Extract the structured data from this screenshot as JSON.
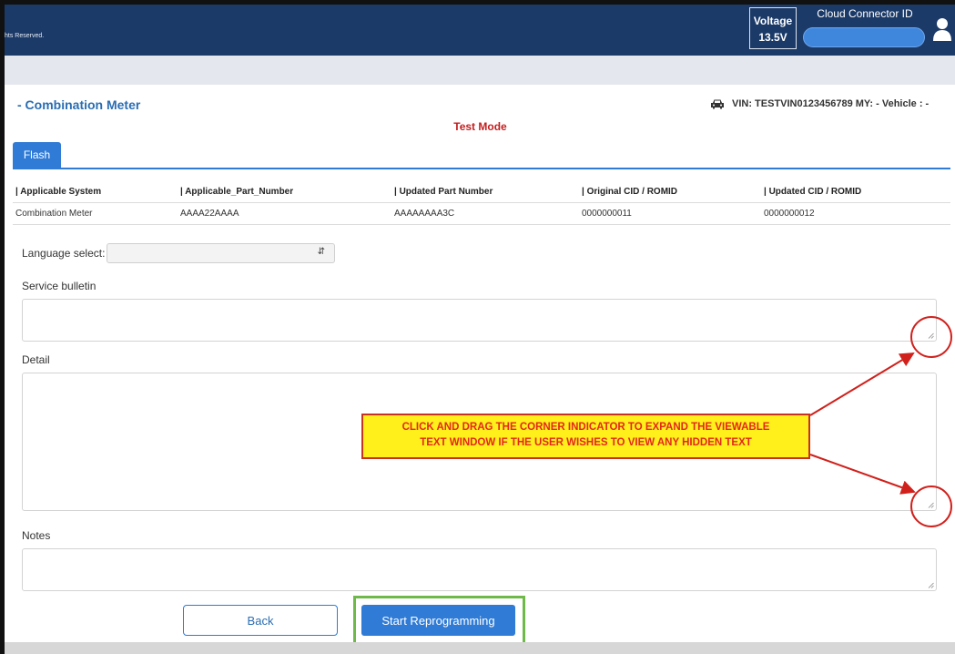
{
  "header": {
    "copyright": "hts Reserved.",
    "voltage_label": "Voltage",
    "voltage_value": "13.5V",
    "cloud_connector_label": "Cloud Connector ID",
    "cloud_connector_value": "",
    "user_icon": "user-icon"
  },
  "module": {
    "title": "- Combination Meter",
    "vin_text": "VIN: TESTVIN0123456789  MY: -  Vehicle : -",
    "car_icon": "car-icon",
    "mode": "Test Mode"
  },
  "tabs": [
    {
      "label": "Flash"
    }
  ],
  "parts_table": {
    "headers": [
      "| Applicable System",
      "| Applicable_Part_Number",
      "| Updated Part Number",
      "| Original CID / ROMID",
      "| Updated CID / ROMID"
    ],
    "rows": [
      [
        "Combination Meter",
        "AAAA22AAAA",
        "AAAAAAAA3C",
        "0000000011",
        "0000000012"
      ]
    ]
  },
  "form": {
    "language_label": "Language select:",
    "language_value": "",
    "service_bulletin_label": "Service bulletin",
    "service_bulletin_value": "",
    "detail_label": "Detail",
    "detail_value": "",
    "notes_label": "Notes",
    "notes_value": ""
  },
  "annotation": {
    "line1": "CLICK AND DRAG THE CORNER INDICATOR TO EXPAND THE VIEWABLE",
    "line2": "TEXT WINDOW IF THE USER WISHES TO VIEW ANY HIDDEN TEXT"
  },
  "buttons": {
    "back": "Back",
    "start": "Start Reprogramming"
  },
  "colors": {
    "header_bg": "#1b3a68",
    "accent": "#2f7bd6",
    "test_mode": "#c41e1e",
    "callout_bg": "#ffef1a",
    "annotation_red": "#d0211c",
    "highlight_green": "#6fb84a"
  }
}
